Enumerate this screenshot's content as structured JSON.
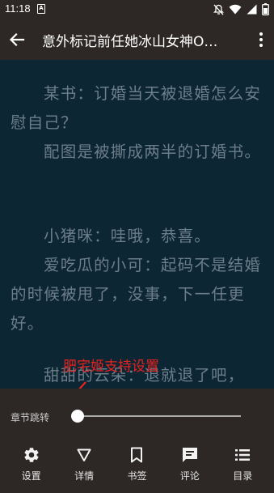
{
  "status_bar": {
    "time": "11:18",
    "app_icon_letter": "A",
    "icons": [
      "notifications-off-icon",
      "wifi-icon",
      "signal-icon",
      "battery-icon"
    ]
  },
  "toolbar": {
    "title": "意外标记前任她冰山女神O…",
    "back_icon": "arrow-left-icon",
    "more_icon": "more-vertical-icon"
  },
  "reader": {
    "paragraphs": [
      "某书：订婚当天被退婚怎么安慰自己？",
      "配图是被撕成两半的订婚书。",
      "小猪咪：哇哦，恭喜。",
      "爱吃瓜的小可：起码不是结婚的时候被甩了，没事，下一任更好。",
      "甜甜的云朵：退就退了吧，"
    ]
  },
  "annotation": {
    "text": "肥宅姬支持设置",
    "color": "#e8231f"
  },
  "chapter_jump": {
    "label": "章节跳转",
    "progress": 0
  },
  "bottom_nav": {
    "items": [
      {
        "label": "设置",
        "icon": "gear-icon"
      },
      {
        "label": "详情",
        "icon": "triangle-down-icon"
      },
      {
        "label": "书签",
        "icon": "bookmark-icon"
      },
      {
        "label": "评论",
        "icon": "comment-icon"
      },
      {
        "label": "目录",
        "icon": "list-icon"
      }
    ]
  },
  "colors": {
    "reader_background": "#0d2633",
    "reader_text": "#6c7e8a",
    "chrome": "#2d2826"
  }
}
